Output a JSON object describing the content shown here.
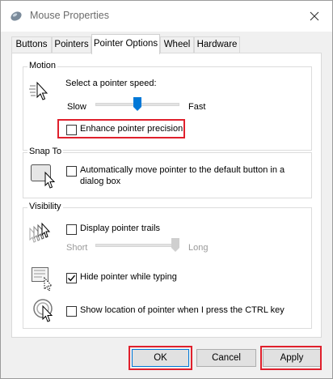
{
  "window": {
    "title": "Mouse Properties",
    "icon": "mouse-icon"
  },
  "tabs": [
    {
      "label": "Buttons",
      "active": false
    },
    {
      "label": "Pointers",
      "active": false
    },
    {
      "label": "Pointer Options",
      "active": true
    },
    {
      "label": "Wheel",
      "active": false
    },
    {
      "label": "Hardware",
      "active": false
    }
  ],
  "motion": {
    "label": "Motion",
    "speed_label": "Select a pointer speed:",
    "slow": "Slow",
    "fast": "Fast",
    "speed_value": 0.5,
    "enhance_label": "Enhance pointer precision",
    "enhance_checked": false
  },
  "snap_to": {
    "label": "Snap To",
    "checkbox_label": "Automatically move pointer to the default button in a dialog box",
    "checkbox_label_line1": "Automatically move pointer to the default button in a",
    "checkbox_label_line2": "dialog box",
    "checked": false
  },
  "visibility": {
    "label": "Visibility",
    "trails_label": "Display pointer trails",
    "trails_checked": false,
    "short": "Short",
    "long": "Long",
    "trails_value": 1.0,
    "hide_label": "Hide pointer while typing",
    "hide_checked": true,
    "ctrl_label": "Show location of pointer when I press the CTRL key",
    "ctrl_checked": false
  },
  "buttons": {
    "ok": "OK",
    "cancel": "Cancel",
    "apply": "Apply"
  },
  "colors": {
    "highlight": "#e0202c",
    "accent": "#0078d7"
  }
}
